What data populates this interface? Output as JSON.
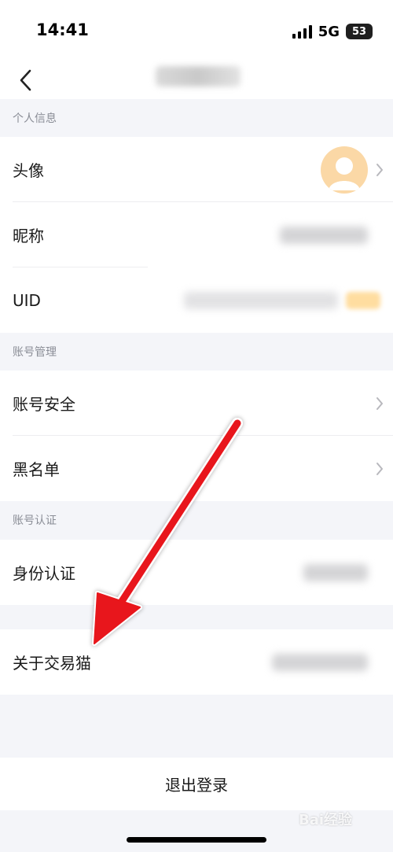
{
  "status_bar": {
    "time": "14:41",
    "network": "5G",
    "battery": "53"
  },
  "sections": [
    {
      "header": "个人信息",
      "rows": [
        {
          "label": "头像"
        },
        {
          "label": "昵称"
        },
        {
          "label": "UID"
        }
      ]
    },
    {
      "header": "账号管理",
      "rows": [
        {
          "label": "账号安全"
        },
        {
          "label": "黑名单"
        }
      ]
    },
    {
      "header": "账号认证",
      "rows": [
        {
          "label": "身份认证"
        }
      ]
    },
    {
      "rows": [
        {
          "label": "关于交易猫"
        }
      ]
    }
  ],
  "logout_label": "退出登录",
  "watermark": "Bai经验",
  "colors": {
    "arrow": "#e8131a",
    "avatar_bg": "#fbd8a6",
    "page_bg": "#f4f5f9"
  }
}
